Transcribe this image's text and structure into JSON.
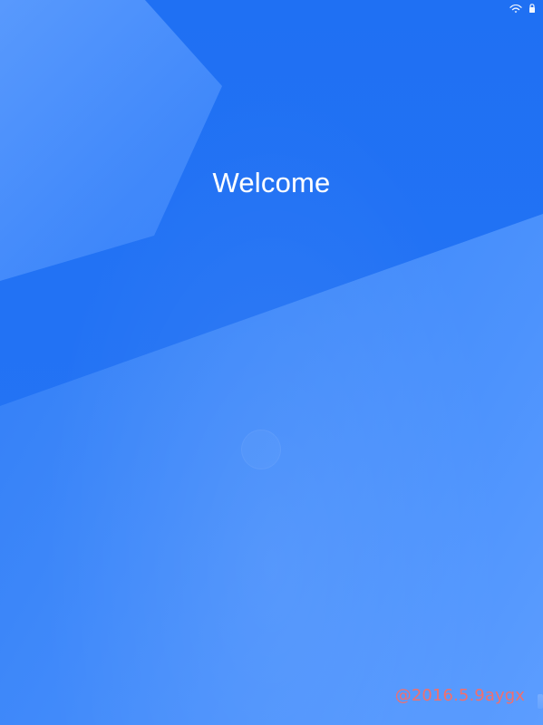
{
  "screen": {
    "title": "Welcome",
    "watermark": "@2016.5.9aygx",
    "status_icons": [
      "wifi-icon",
      "lock-icon"
    ]
  }
}
